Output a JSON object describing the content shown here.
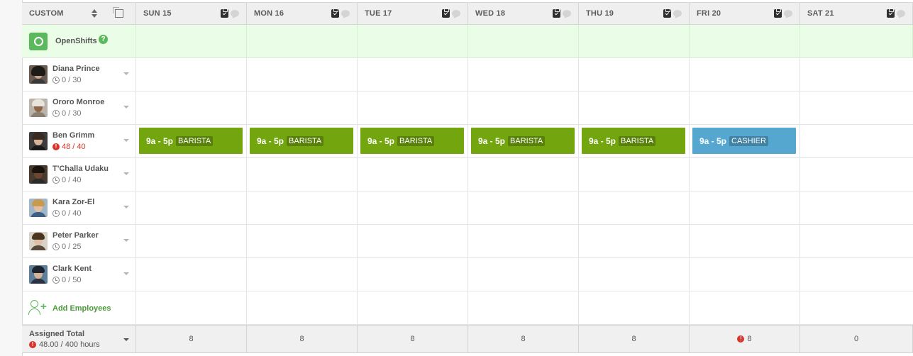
{
  "header": {
    "view_label": "CUSTOM",
    "days": [
      "SUN 15",
      "MON 16",
      "TUE 17",
      "WED 18",
      "THU 19",
      "FRI 20",
      "SAT 21"
    ]
  },
  "open_shifts": {
    "label": "OpenShifts",
    "help": "?"
  },
  "employees": [
    {
      "name": "Diana Prince",
      "hours": "0 / 30",
      "over": false
    },
    {
      "name": "Ororo Monroe",
      "hours": "0 / 30",
      "over": false
    },
    {
      "name": "Ben Grimm",
      "hours": "48 / 40",
      "over": true
    },
    {
      "name": "T'Challa Udaku",
      "hours": "0 / 40",
      "over": false
    },
    {
      "name": "Kara Zor-El",
      "hours": "0 / 40",
      "over": false
    },
    {
      "name": "Peter Parker",
      "hours": "0 / 25",
      "over": false
    },
    {
      "name": "Clark Kent",
      "hours": "0 / 50",
      "over": false
    }
  ],
  "shifts": {
    "ben_grimm": [
      {
        "time": "9a - 5p",
        "position": "BARISTA",
        "color": "#72a50e"
      },
      {
        "time": "9a - 5p",
        "position": "BARISTA",
        "color": "#72a50e"
      },
      {
        "time": "9a - 5p",
        "position": "BARISTA",
        "color": "#72a50e"
      },
      {
        "time": "9a - 5p",
        "position": "BARISTA",
        "color": "#72a50e"
      },
      {
        "time": "9a - 5p",
        "position": "BARISTA",
        "color": "#72a50e"
      },
      {
        "time": "9a - 5p",
        "position": "CASHIER",
        "color": "#55a7d0"
      }
    ]
  },
  "add_employees": {
    "label": "Add Employees"
  },
  "totals": {
    "label": "Assigned Total",
    "hours": "48.00 / 400 hours",
    "day_totals": [
      "8",
      "8",
      "8",
      "8",
      "8",
      "8",
      "0"
    ],
    "day_alerts": [
      false,
      false,
      false,
      false,
      false,
      true,
      false
    ]
  },
  "colors": {
    "accent_green": "#5cb85c",
    "barista": "#72a50e",
    "cashier": "#55a7d0",
    "alert": "#d9342b",
    "open_row": "#eafde6"
  }
}
